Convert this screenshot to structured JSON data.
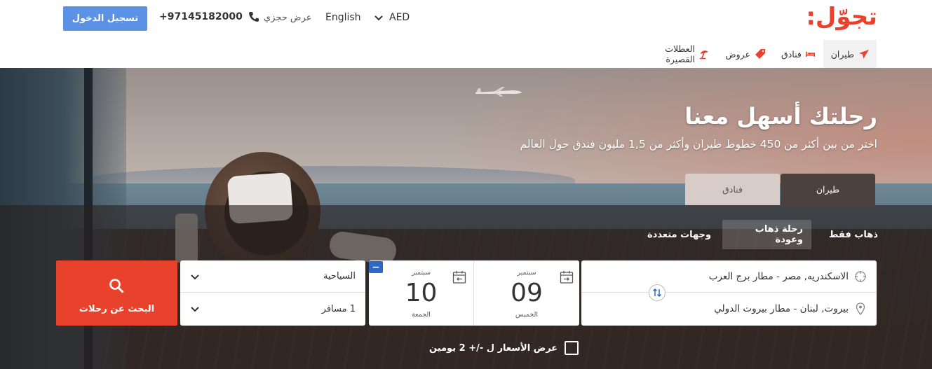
{
  "header": {
    "logo": "تجوّل:",
    "currency": "AED",
    "language": "English",
    "my_booking": "عرض حجزي",
    "phone": "+97145182000",
    "login": "تسجيل الدخول"
  },
  "nav": {
    "items": [
      {
        "label": "طيران",
        "icon": "plane-icon"
      },
      {
        "label": "فنادق",
        "icon": "bed-icon"
      },
      {
        "label": "عروض",
        "icon": "tag-icon"
      },
      {
        "label": "العطلات القصيرة",
        "icon": "beach-umbrella-icon"
      }
    ]
  },
  "hero": {
    "title": "رحلتك أسهل معنا",
    "subtitle": "اختر من بين أكثر من 450 خطوط طيران وأكثر من 1,5 مليون فندق حول العالم"
  },
  "tabs": {
    "flights": "طيران",
    "hotels": "فنادق"
  },
  "trip_types": {
    "one_way": "ذهاب فقط",
    "round_trip": "رحلة ذهاب وعودة",
    "multi_city": "وجهات متعددة"
  },
  "form": {
    "from": "الاسكندريه, مصر - مطار برج العرب",
    "to": "بيروت, لبنان - مطار بيروت الدولي",
    "depart": {
      "month": "سبتمبر",
      "day": "09",
      "weekday": "الخميس"
    },
    "return": {
      "month": "سبتمبر",
      "day": "10",
      "weekday": "الجمعة"
    },
    "cabin_class": "السياحية",
    "passengers": "1 مسافر",
    "search": "البحث عن رحلات",
    "flexible_dates": "عرض الأسعار ل -/+ 2 يومين"
  },
  "colors": {
    "brand": "#e8412c",
    "login": "#5b92e5",
    "remove": "#2f67c8"
  }
}
